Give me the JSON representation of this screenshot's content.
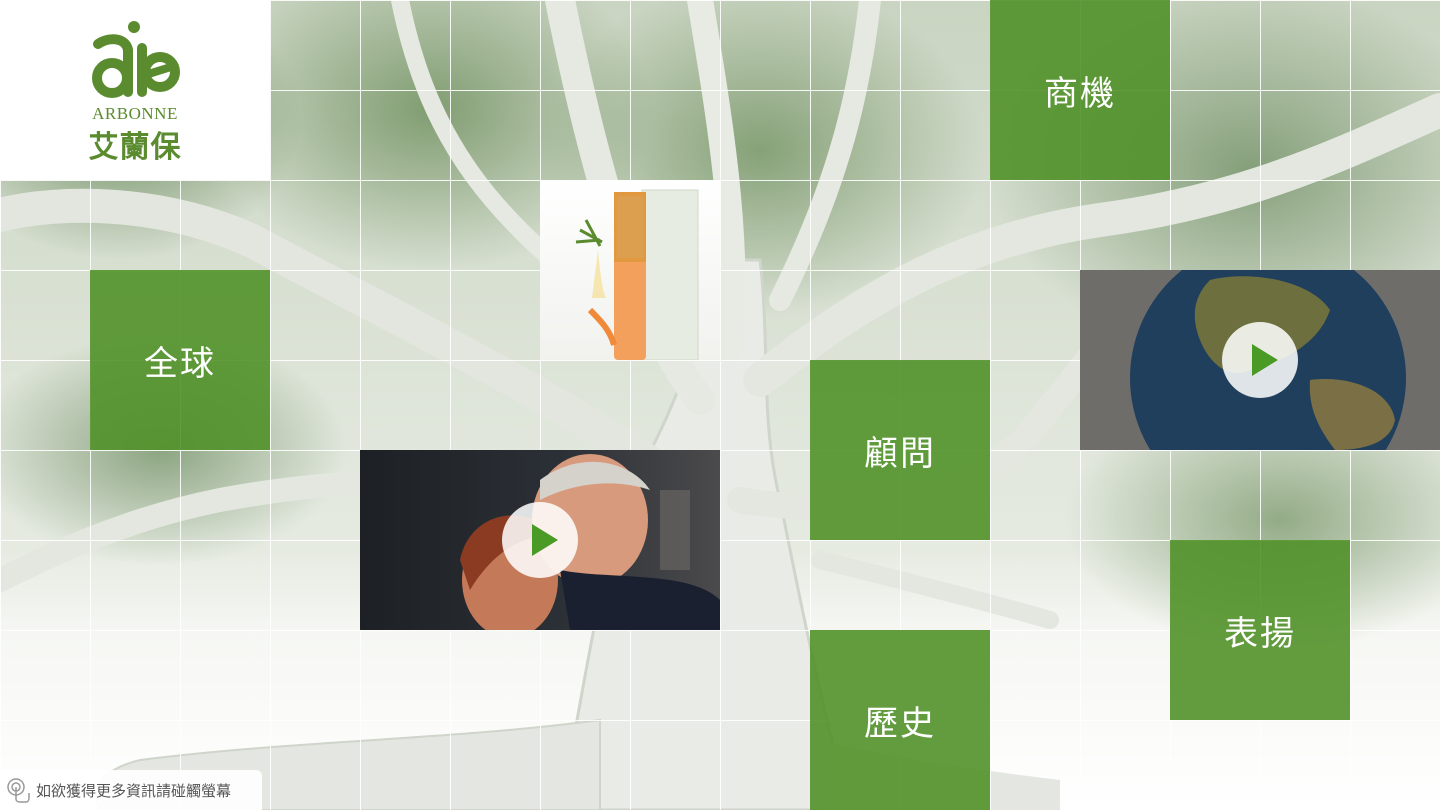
{
  "brand": {
    "name": "ARBONNE",
    "chinese_name": "艾蘭保",
    "color": "#5a8b2e"
  },
  "tiles": [
    {
      "label": "商機"
    },
    {
      "label": "全球"
    },
    {
      "label": "顧問"
    },
    {
      "label": "表揚"
    },
    {
      "label": "歷史"
    }
  ],
  "tile_color": "#519129",
  "media": [
    {
      "kind": "product-image"
    },
    {
      "kind": "video",
      "icon": "play-icon"
    },
    {
      "kind": "video",
      "icon": "play-icon"
    }
  ],
  "hint": {
    "text": "如欲獲得更多資訊請碰觸螢幕",
    "icon": "touch-icon"
  }
}
